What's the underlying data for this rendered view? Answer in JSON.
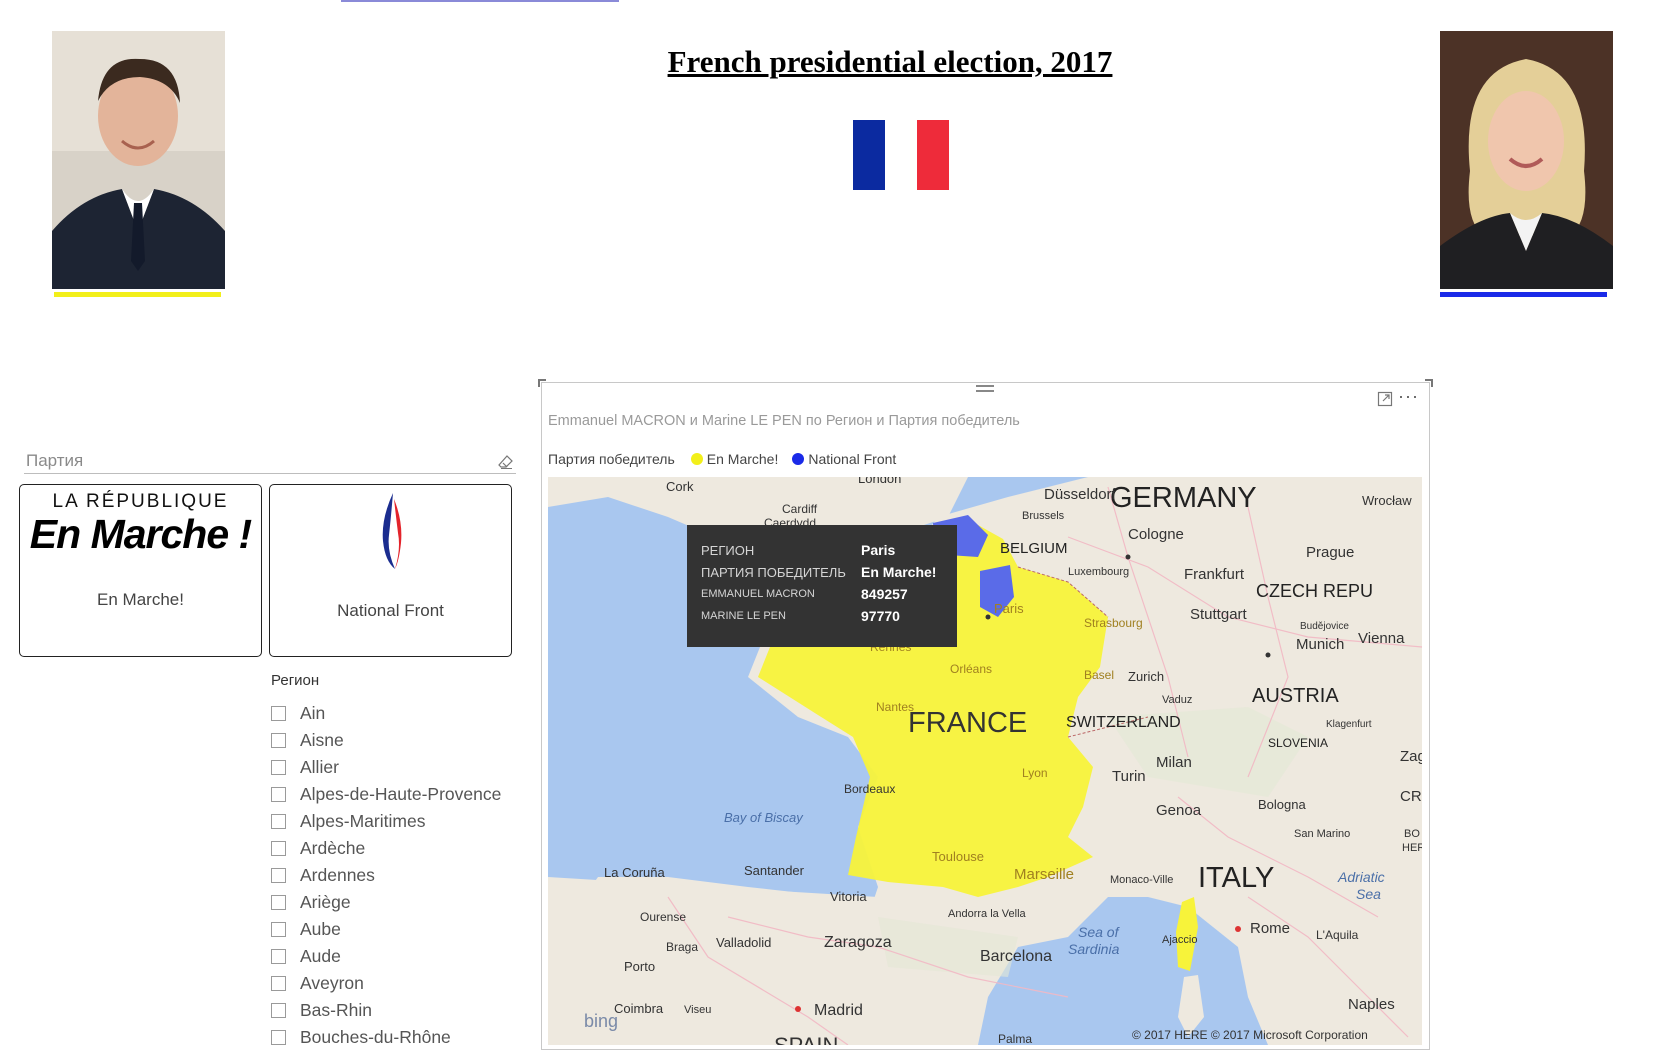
{
  "report": {
    "title": "French presidential election, 2017",
    "flag_colors": [
      "#0b2aa0",
      "#ffffff",
      "#ee2b3a"
    ]
  },
  "candidates": {
    "left": {
      "underline_color": "#f2ef1a"
    },
    "right": {
      "underline_color": "#1a2ae8"
    }
  },
  "party_slicer": {
    "header": "Партия",
    "items": [
      {
        "logo_top": "LA RÉPUBLIQUE",
        "logo_main": "En Marche !",
        "label": "En Marche!"
      },
      {
        "label": "National Front"
      }
    ]
  },
  "region_slicer": {
    "title": "Регион",
    "items": [
      "Ain",
      "Aisne",
      "Allier",
      "Alpes-de-Haute-Provence",
      "Alpes-Maritimes",
      "Ardèche",
      "Ardennes",
      "Ariège",
      "Aube",
      "Aude",
      "Aveyron",
      "Bas-Rhin",
      "Bouches-du-Rhône"
    ]
  },
  "map_visual": {
    "title": "Emmanuel MACRON  и Marine LE PEN по Регион и Партия победитель",
    "legend_title": "Партия победитель",
    "legend": [
      {
        "label": "En Marche!",
        "color": "#f2ef1a"
      },
      {
        "label": "National Front",
        "color": "#1a2ae8"
      }
    ],
    "fill_colors": {
      "en_marche": "#f7f33a",
      "national_front": "#5a6be8"
    },
    "labels": {
      "germany": "GERMANY",
      "france": "FRANCE",
      "italy": "ITALY",
      "austria": "AUSTRIA",
      "czech": "CZECH REPU",
      "switzerland": "SWITZERLAND",
      "belgium": "BELGIUM",
      "slovenia": "SLOVENIA",
      "bay_biscay": "Bay of Biscay",
      "sea_sardinia_1": "Sea of",
      "sea_sardinia_2": "Sardinia",
      "adriatic_1": "Adriatic",
      "adriatic_2": "Sea",
      "cities": [
        "Cork",
        "London",
        "Cardiff",
        "Caerdydd",
        "Düsseldorf",
        "Brussels",
        "Cologne",
        "Wrocław",
        "Prague",
        "Frankfurt",
        "Luxembourg",
        "Stuttgart",
        "Strasbourg",
        "Paris",
        "Rennes",
        "Orléans",
        "Nantes",
        "Munich",
        "Vienna",
        "Budějovice",
        "Zurich",
        "Basel",
        "Vaduz",
        "Klagenfurt",
        "Milan",
        "Turin",
        "Lyon",
        "Bordeaux",
        "Genoa",
        "Bologna",
        "San Marino",
        "Toulouse",
        "Marseille",
        "Monaco-Ville",
        "Santander",
        "La Coruña",
        "Vitoria",
        "Andorra la Vella",
        "Ourense",
        "Braga",
        "Valladolid",
        "Zaragoza",
        "Barcelona",
        "Ajaccio",
        "Rome",
        "L'Aquila",
        "Porto",
        "Coimbra",
        "Viseu",
        "Madrid",
        "Naples",
        "Palma",
        "Zag",
        "CRO",
        "BO",
        "HER",
        "SPAIN"
      ],
      "copyright": "© 2017 HERE   © 2017 Microsoft Corporation",
      "bing": "bing"
    }
  },
  "tooltip": {
    "rows": [
      {
        "key": "РЕГИОН",
        "value": "Paris"
      },
      {
        "key": "ПАРТИЯ ПОБЕДИТЕЛЬ",
        "value": "En Marche!"
      },
      {
        "key": "EMMANUEL MACRON",
        "value": "849257"
      },
      {
        "key": "MARINE LE PEN",
        "value": "97770"
      }
    ]
  }
}
